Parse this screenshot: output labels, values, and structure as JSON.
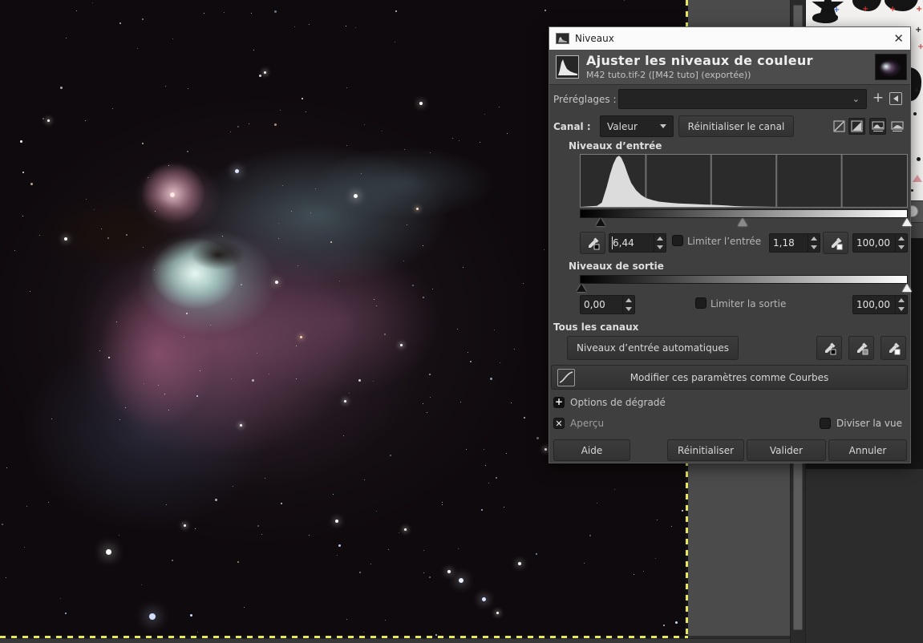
{
  "dialog": {
    "window_title": "Niveaux",
    "close_glyph": "✕",
    "header": {
      "title": "Ajuster les niveaux de couleur",
      "subtitle": "M42 tuto.tif-2 ([M42 tuto] (exportée))"
    },
    "presets": {
      "label": "Préréglages :",
      "value": "",
      "chevron": "⌄",
      "add_glyph": "+"
    },
    "channel": {
      "label": "Canal :",
      "value": "Valeur",
      "reset_button": "Réinitialiser le canal"
    },
    "input_levels": {
      "heading": "Niveaux d’entrée",
      "low_value": "6,44",
      "gamma_value": "1,18",
      "high_value": "100,00",
      "clamp_label": "Limiter l’entrée",
      "slider_positions": {
        "low_pct": 6.4,
        "mid_pct": 49.7,
        "high_pct": 99.8
      }
    },
    "output_levels": {
      "heading": "Niveaux de sortie",
      "low_value": "0,00",
      "high_value": "100,00",
      "clamp_label": "Limiter la sortie",
      "slider_positions": {
        "low_pct": 0.4,
        "high_pct": 99.8
      }
    },
    "all_channels": {
      "heading": "Tous les canaux",
      "auto_button": "Niveaux d’entrée automatiques",
      "curves_button": "Modifier ces paramètres comme Courbes"
    },
    "gradient_options_label": "Options de dégradé",
    "preview_label": "Aperçu",
    "preview_checked": true,
    "split_view_label": "Diviser la vue",
    "split_view_checked": false,
    "buttons": {
      "help": "Aide",
      "reset": "Réinitialiser",
      "ok": "Valider",
      "cancel": "Annuler"
    },
    "histogram": {
      "points": [
        [
          0,
          0
        ],
        [
          5,
          2
        ],
        [
          6.5,
          8
        ],
        [
          8,
          38
        ],
        [
          9,
          62
        ],
        [
          10,
          82
        ],
        [
          11,
          95
        ],
        [
          11.8,
          98
        ],
        [
          12.5,
          94
        ],
        [
          13.5,
          80
        ],
        [
          14.5,
          62
        ],
        [
          15.5,
          46
        ],
        [
          17,
          32
        ],
        [
          18.5,
          23
        ],
        [
          20,
          17
        ],
        [
          22,
          13
        ],
        [
          24,
          10
        ],
        [
          27,
          8
        ],
        [
          30,
          6.5
        ],
        [
          34,
          5.5
        ],
        [
          38,
          4.5
        ],
        [
          42,
          3.5
        ],
        [
          45,
          2.5
        ],
        [
          47,
          1.5
        ],
        [
          50,
          0.8
        ],
        [
          55,
          0.3
        ],
        [
          60,
          0
        ],
        [
          100,
          0
        ]
      ],
      "gridlines_pct": [
        20,
        40,
        60,
        80
      ]
    }
  }
}
